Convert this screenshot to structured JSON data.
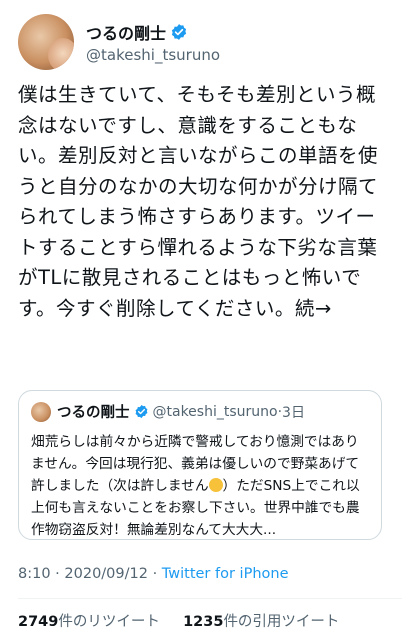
{
  "author": {
    "display_name": "つるの剛士",
    "handle": "@takeshi_tsuruno",
    "avatar_icon": "avatar-photo"
  },
  "tweet": {
    "text": "僕は生きていて、そもそも差別という概念はないですし、意識をすることもない。差別反対と言いながらこの単語を使うと自分のなかの大切な何かが分け隔てられてしまう怖さすらあります。ツイートすることすら憚れるような下劣な言葉がTLに散見されることはもっと怖いです。今すぐ削除してください。続→"
  },
  "quoted_tweet": {
    "display_name": "つるの剛士",
    "handle": "@takeshi_tsuruno",
    "separator": "·",
    "age": "3日",
    "text_before_emoji": "畑荒らしは前々から近隣で警戒しており憶測ではありません。今回は現行犯、義弟は優しいので野菜あげて許しました（次は許しません",
    "emoji": "angry-face-emoji",
    "text_after_emoji": "）ただSNS上でこれ以上何も言えないことをお察し下さい。世界中誰でも農作物窃盗反対！無論差別なんて大大大..."
  },
  "timestamp": {
    "time": "8:10",
    "separator": " · ",
    "date": "2020/09/12",
    "source_separator": " · ",
    "source": "Twitter for iPhone"
  },
  "stats": {
    "retweets_count": "2749",
    "retweets_label": "件のリツイート",
    "quotes_count": "1235",
    "quotes_label": "件の引用ツイート"
  },
  "colors": {
    "accent": "#1d9bf0",
    "text": "#0f1419",
    "secondary": "#536471",
    "border": "#cfd9de"
  }
}
